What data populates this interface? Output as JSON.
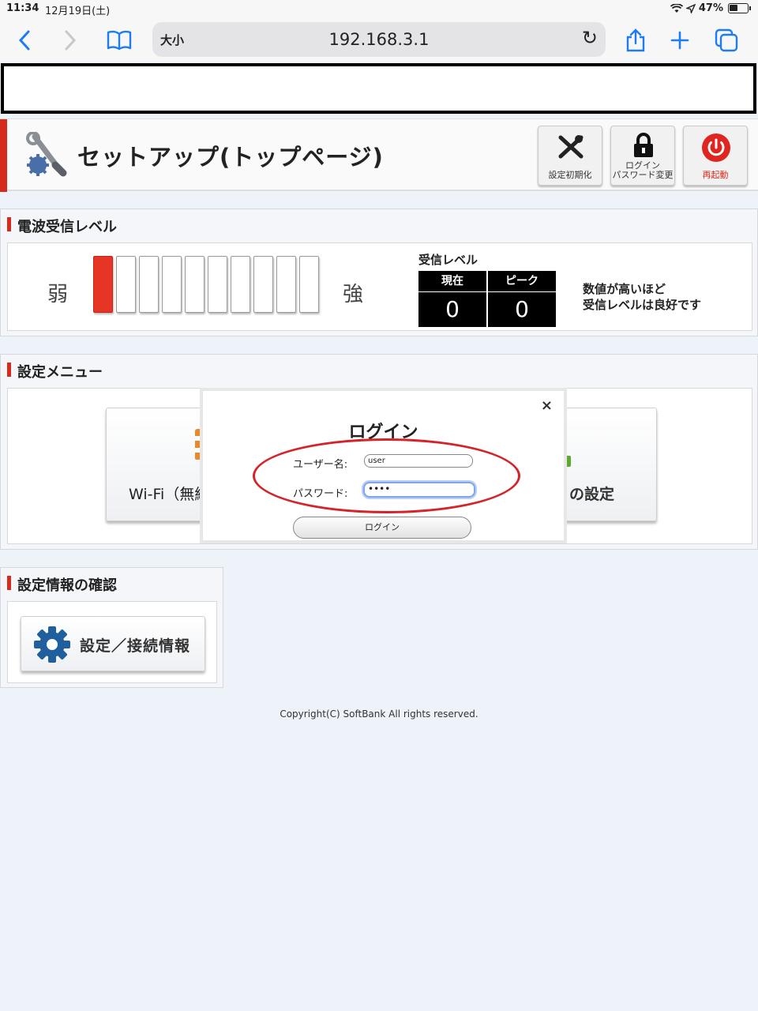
{
  "status_bar": {
    "time": "11:34",
    "date": "12月19日(土)",
    "battery": "47%"
  },
  "browser": {
    "text_size": "大小",
    "url": "192.168.3.1"
  },
  "header": {
    "title": "セットアップ(トップページ)",
    "buttons": [
      {
        "label": "設定初期化",
        "icon": "tools-icon"
      },
      {
        "label": "ログイン\nパスワード変更",
        "icon": "lock-icon"
      },
      {
        "label": "再起動",
        "icon": "power-icon"
      }
    ]
  },
  "signal": {
    "title": "電波受信レベル",
    "weak_label": "弱",
    "strong_label": "強",
    "bars_total": 10,
    "bars_lit": 1,
    "level_title": "受信レベル",
    "current_label": "現在",
    "peak_label": "ピーク",
    "current_value": "0",
    "peak_value": "0",
    "note_line1": "数値が高いほど",
    "note_line2": "受信レベルは良好です"
  },
  "settings_menu": {
    "title": "設定メニュー",
    "left_button": "Wi-Fi（無線",
    "right_button": "の設定"
  },
  "confirm": {
    "title": "設定情報の確認",
    "button": "設定／接続情報"
  },
  "footer": {
    "copyright": "Copyright(C) SoftBank All rights reserved."
  },
  "modal": {
    "title": "ログイン",
    "close": "×",
    "username_label": "ユーザー名:",
    "username_value": "user",
    "password_label": "パスワード:",
    "password_value": "••••",
    "login_button": "ログイン"
  },
  "colors": {
    "accent_red": "#d52a1c",
    "link_blue": "#1e7cf0",
    "signal_on": "#e63525"
  }
}
